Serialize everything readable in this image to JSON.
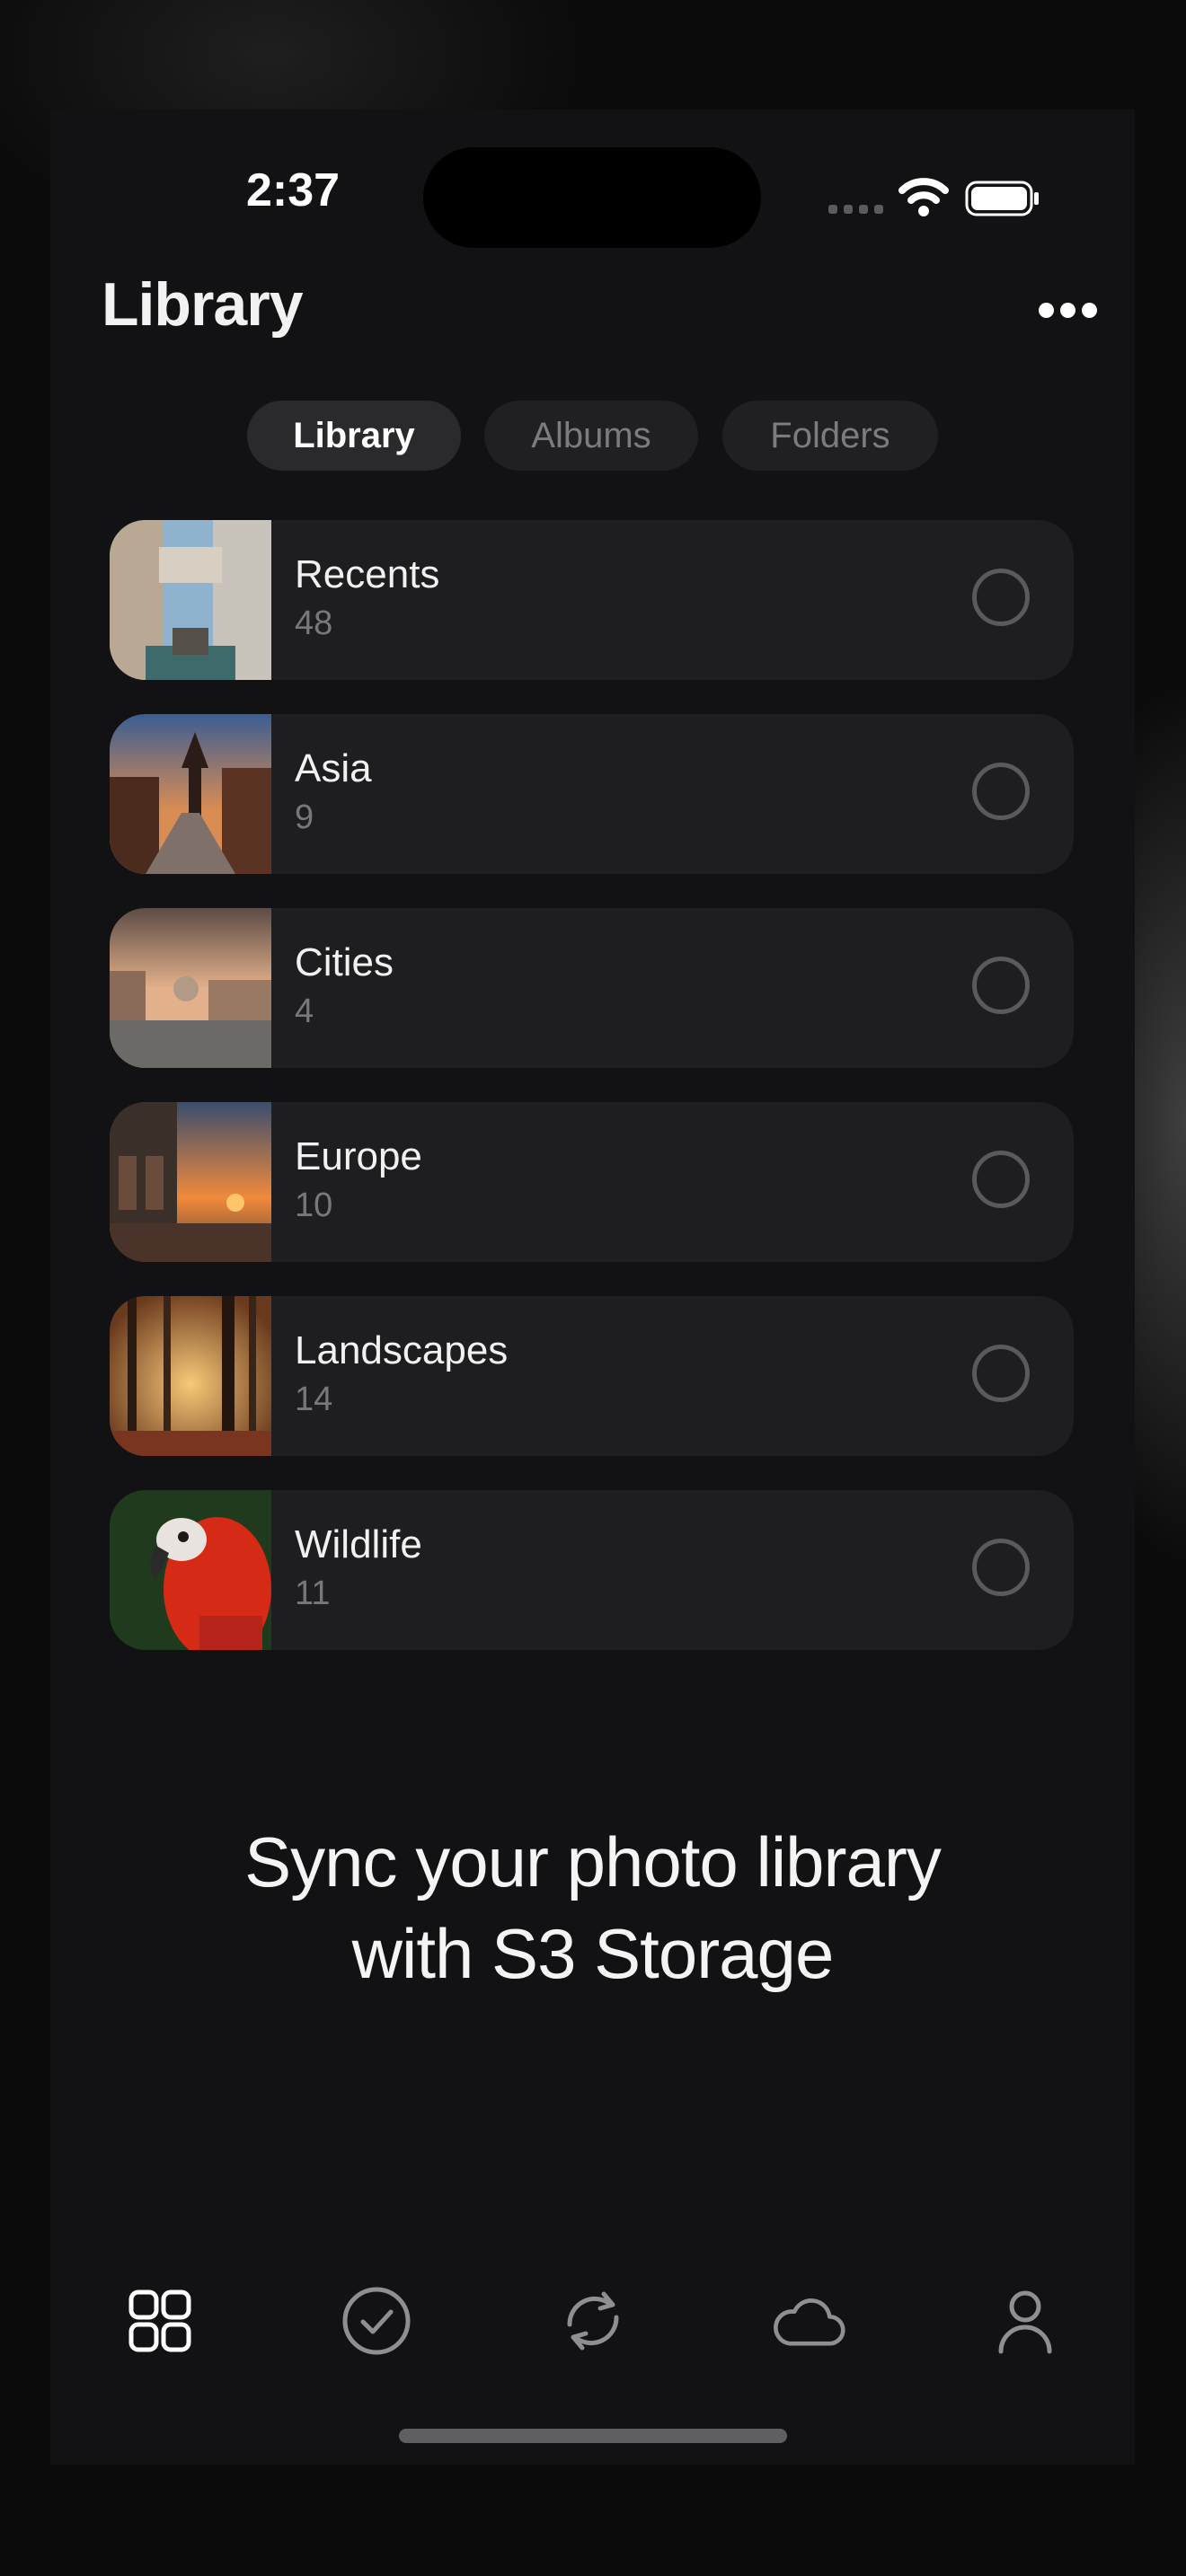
{
  "status_bar": {
    "time": "2:37"
  },
  "header": {
    "title": "Library"
  },
  "segments": [
    {
      "label": "Library",
      "active": true
    },
    {
      "label": "Albums",
      "active": false
    },
    {
      "label": "Folders",
      "active": false
    }
  ],
  "albums": [
    {
      "name": "Recents",
      "count": "48",
      "thumb": "venice-bridge-icon"
    },
    {
      "name": "Asia",
      "count": "9",
      "thumb": "pagoda-street-icon"
    },
    {
      "name": "Cities",
      "count": "4",
      "thumb": "venice-canal-icon"
    },
    {
      "name": "Europe",
      "count": "10",
      "thumb": "sunset-plaza-icon"
    },
    {
      "name": "Landscapes",
      "count": "14",
      "thumb": "forest-sun-icon"
    },
    {
      "name": "Wildlife",
      "count": "11",
      "thumb": "parrot-icon"
    }
  ],
  "promo": {
    "line1": "Sync your photo library",
    "line2": "with S3 Storage"
  },
  "tabbar": [
    {
      "icon": "grid-icon",
      "selected": true
    },
    {
      "icon": "checkmark-circle-icon",
      "selected": false
    },
    {
      "icon": "sync-icon",
      "selected": false
    },
    {
      "icon": "cloud-icon",
      "selected": false
    },
    {
      "icon": "person-icon",
      "selected": false
    }
  ],
  "colors": {
    "background": "#121214",
    "card": "#1e1e20",
    "secondary_text": "#78787c"
  }
}
